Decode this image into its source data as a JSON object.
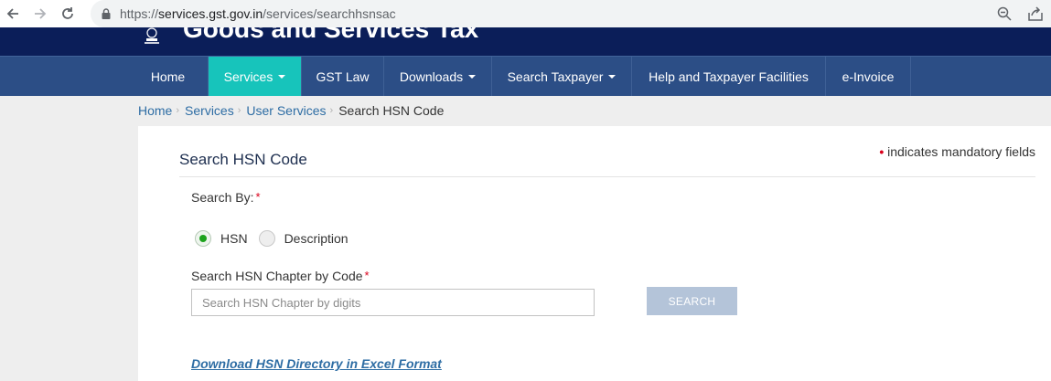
{
  "browser": {
    "url_proto": "https://",
    "url_host": "services.gst.gov.in",
    "url_path": "/services/searchhsnsac"
  },
  "header": {
    "title": "Goods and Services Tax"
  },
  "nav": {
    "items": [
      {
        "label": "Home",
        "dropdown": false
      },
      {
        "label": "Services",
        "dropdown": true,
        "active": true
      },
      {
        "label": "GST Law",
        "dropdown": false
      },
      {
        "label": "Downloads",
        "dropdown": true
      },
      {
        "label": "Search Taxpayer",
        "dropdown": true
      },
      {
        "label": "Help and Taxpayer Facilities",
        "dropdown": false
      },
      {
        "label": "e-Invoice",
        "dropdown": false
      }
    ]
  },
  "breadcrumb": {
    "items": [
      "Home",
      "Services",
      "User Services"
    ],
    "current": "Search HSN Code"
  },
  "form": {
    "mandatory_note": "indicates mandatory fields",
    "title": "Search HSN Code",
    "search_by_label": "Search By:",
    "radio_options": [
      {
        "label": "HSN",
        "checked": true
      },
      {
        "label": "Description",
        "checked": false
      }
    ],
    "chapter_label": "Search HSN Chapter by Code",
    "input_placeholder": "Search HSN Chapter by digits",
    "input_value": "",
    "search_button": "SEARCH",
    "download_link": "Download HSN Directory in Excel Format"
  },
  "colors": {
    "header_bg": "#0b1e59",
    "nav_bg": "#2c4e86",
    "nav_active": "#17c4bb",
    "link": "#2e6da4",
    "required": "#d9001b",
    "button_disabled": "#b4c4d9"
  }
}
